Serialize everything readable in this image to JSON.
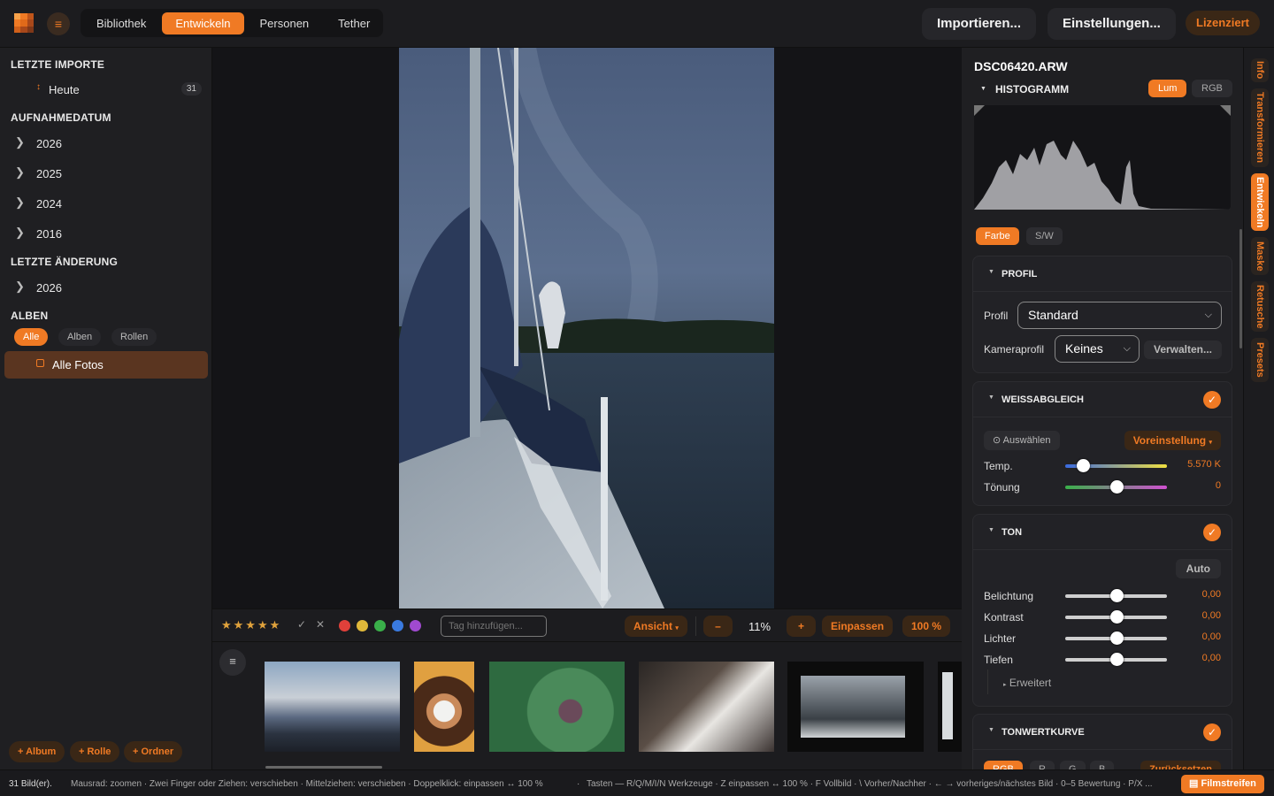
{
  "topbar": {
    "tabs": [
      "Bibliothek",
      "Entwickeln",
      "Personen",
      "Tether"
    ],
    "active_tab": "Entwickeln",
    "import_label": "Importieren...",
    "settings_label": "Einstellungen...",
    "license_label": "Lizenziert"
  },
  "sidebar": {
    "recent_imports": {
      "title": "LETZTE IMPORTE",
      "item": "Heute",
      "count": "31"
    },
    "capture_date": {
      "title": "AUFNAHMEDATUM",
      "years": [
        "2026",
        "2025",
        "2024",
        "2016"
      ]
    },
    "last_change": {
      "title": "LETZTE ÄNDERUNG",
      "years": [
        "2026"
      ]
    },
    "albums": {
      "title": "ALBEN",
      "filters": [
        "Alle",
        "Alben",
        "Rollen"
      ],
      "active_filter": "Alle",
      "item": "Alle Fotos"
    },
    "buttons": [
      "+ Album",
      "+ Rolle",
      "+ Ordner"
    ]
  },
  "toolbar": {
    "stars": "★★★★★",
    "tag_placeholder": "Tag hinzufügen...",
    "view_label": "Ansicht",
    "minus": "–",
    "zoom": "11%",
    "plus": "+",
    "fit_label": "Einpassen",
    "full_label": "100 %",
    "colors": [
      "#e0403a",
      "#e0b83a",
      "#3ab04a",
      "#3a7ae0",
      "#a04ad0"
    ]
  },
  "right": {
    "filename": "DSC06420.ARW",
    "histogram": {
      "title": "HISTOGRAMM",
      "modes": [
        "Lum",
        "RGB"
      ],
      "active": "Lum"
    },
    "color_modes": [
      "Farbe",
      "S/W"
    ],
    "active_color_mode": "Farbe",
    "profile": {
      "title": "PROFIL",
      "profile_label": "Profil",
      "profile_value": "Standard",
      "camera_label": "Kameraprofil",
      "camera_value": "Keines",
      "manage_label": "Verwalten..."
    },
    "whitebalance": {
      "title": "WEISSABGLEICH",
      "pick_label": "Auswählen",
      "preset_label": "Voreinstellung",
      "temp_label": "Temp.",
      "temp_value": "5.570 K",
      "temp_pos": 0.17,
      "tint_label": "Tönung",
      "tint_value": "0",
      "tint_pos": 0.5
    },
    "tone": {
      "title": "TON",
      "auto_label": "Auto",
      "sliders": [
        {
          "label": "Belichtung",
          "value": "0,00",
          "pos": 0.5
        },
        {
          "label": "Kontrast",
          "value": "0,00",
          "pos": 0.5
        },
        {
          "label": "Lichter",
          "value": "0,00",
          "pos": 0.5
        },
        {
          "label": "Tiefen",
          "value": "0,00",
          "pos": 0.5
        }
      ],
      "advanced_label": "Erweitert"
    },
    "tonecurve": {
      "title": "TONWERTKURVE",
      "channels": [
        "RGB",
        "R",
        "G",
        "B"
      ],
      "reset_label": "Zurücksetzen"
    }
  },
  "rail": [
    "Info",
    "Transformieren",
    "Entwickeln",
    "Maske",
    "Retusche",
    "Presets"
  ],
  "rail_active": "Entwickeln",
  "status": {
    "count": "31 Bild(er).",
    "hint_mouse": "Mausrad: zoomen · Zwei Finger oder Ziehen: verschieben · Mittelziehen: verschieben · Doppelklick: einpassen ↔ 100 %",
    "hint_keys": "Tasten — R/Q/M/I/N Werkzeuge · Z einpassen ↔ 100 % · F Vollbild · \\ Vorher/Nachher · ← → vorheriges/nächstes Bild · 0–5 Bewertung · P/X ...",
    "filmstrip_label": "Filmstreifen"
  }
}
